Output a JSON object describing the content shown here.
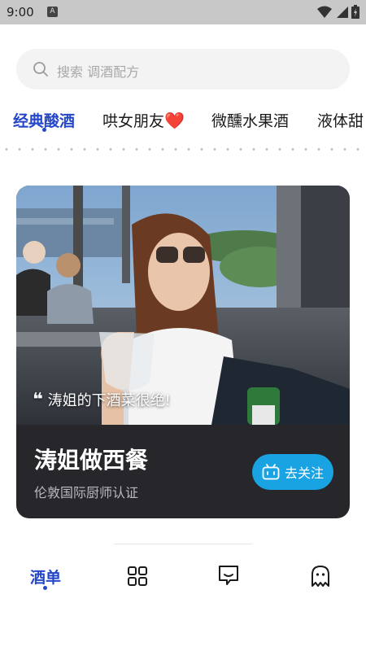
{
  "status_bar": {
    "time": "9:00",
    "notification_badge": "A"
  },
  "search": {
    "placeholder": "搜索 调酒配方"
  },
  "categories": [
    {
      "label": "经典酸酒",
      "active": true
    },
    {
      "label": "哄女朋友",
      "emoji": "❤️",
      "active": false
    },
    {
      "label": "微醺水果酒",
      "active": false
    },
    {
      "label": "液体甜",
      "active": false
    }
  ],
  "card": {
    "quote": "涛姐的下酒菜很绝!",
    "title": "涛姐做西餐",
    "subtitle": "伦敦国际厨师认证",
    "follow_label": "去关注"
  },
  "bottom_nav": [
    {
      "label": "酒单",
      "active": true
    },
    {
      "icon": "grid-icon"
    },
    {
      "icon": "message-icon"
    },
    {
      "icon": "ghost-icon"
    }
  ],
  "colors": {
    "accent": "#2446c9",
    "follow_button": "#1aa3e3",
    "card_bg": "#26262b"
  }
}
